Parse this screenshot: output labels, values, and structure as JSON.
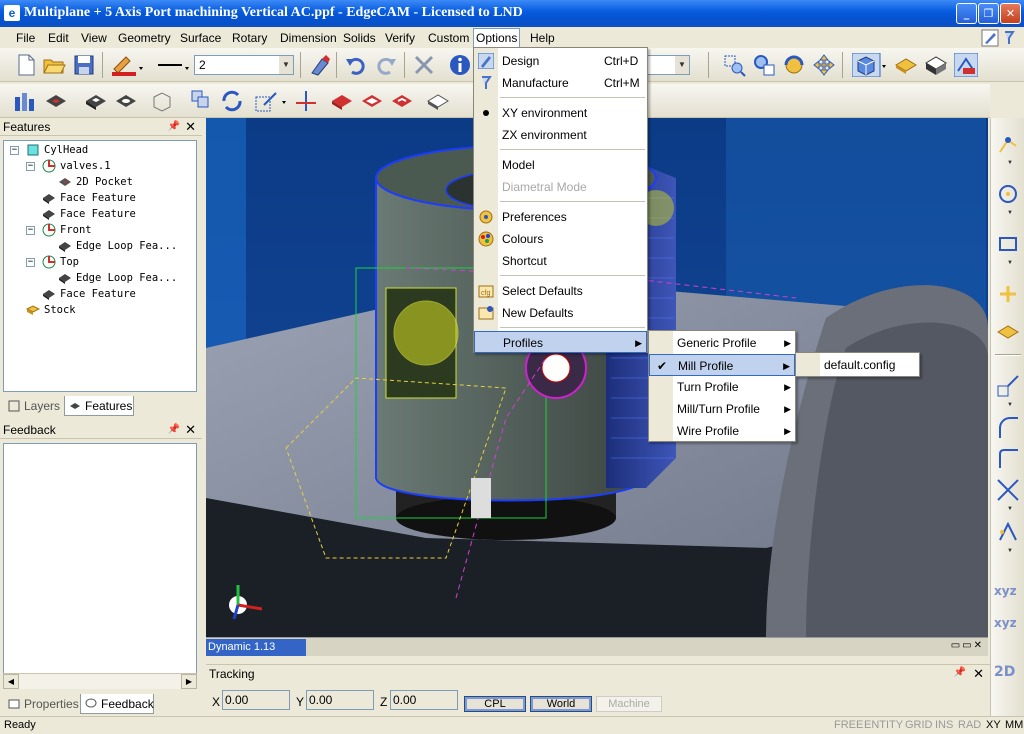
{
  "window": {
    "title": "Multiplane + 5 Axis Port machining Vertical AC.ppf - EdgeCAM - Licensed to LND",
    "app_icon": "edgecam-app-icon",
    "controls": {
      "minimize": "_",
      "maximize": "❐",
      "close": "✕"
    }
  },
  "menubar": {
    "items": [
      "File",
      "Edit",
      "View",
      "Geometry",
      "Surface",
      "Rotary",
      "Dimension",
      "Solids",
      "Verify",
      "Custom",
      "Options",
      "Help"
    ],
    "open_item": "Options"
  },
  "toolbar": {
    "line_weight_value": "2"
  },
  "features_panel": {
    "title": "Features",
    "tree": [
      {
        "label": "CylHead",
        "icon": "cube-icon"
      },
      {
        "label": "valves.1",
        "icon": "plane-icon"
      },
      {
        "label": "2D Pocket",
        "icon": "pocket-icon"
      },
      {
        "label": "Face Feature",
        "icon": "face-feature-icon"
      },
      {
        "label": "Face Feature",
        "icon": "face-feature-icon"
      },
      {
        "label": "Front",
        "icon": "plane-icon"
      },
      {
        "label": "Edge Loop Fea...",
        "icon": "face-feature-icon"
      },
      {
        "label": "Top",
        "icon": "plane-icon"
      },
      {
        "label": "Edge Loop Fea...",
        "icon": "face-feature-icon"
      },
      {
        "label": "Face Feature",
        "icon": "face-feature-icon"
      },
      {
        "label": "Stock",
        "icon": "stock-icon"
      }
    ],
    "tabs": [
      "Layers",
      "Features"
    ],
    "active_tab": "Features"
  },
  "feedback_panel": {
    "title": "Feedback",
    "tabs": [
      "Properties",
      "Feedback"
    ],
    "active_tab": "Feedback"
  },
  "viewport": {
    "status": "Dynamic 1.13"
  },
  "tracking": {
    "title": "Tracking",
    "x_label": "X",
    "x_value": "0.00",
    "y_label": "Y",
    "y_value": "0.00",
    "z_label": "Z",
    "z_value": "0.00",
    "buttons": [
      "CPL",
      "World",
      "Machine"
    ]
  },
  "right_toolbar": {
    "labels": [
      "xyz",
      "xyz",
      "2D"
    ]
  },
  "options_menu": {
    "items": [
      {
        "label": "Design",
        "shortcut": "Ctrl+D",
        "icon": "pen-icon"
      },
      {
        "label": "Manufacture",
        "shortcut": "Ctrl+M",
        "icon": "tool-icon"
      },
      {
        "label": "XY environment",
        "checked": true
      },
      {
        "label": "ZX environment"
      },
      {
        "label": "Model"
      },
      {
        "label": "Diametral Mode",
        "disabled": true
      },
      {
        "label": "Preferences",
        "icon": "preferences-icon"
      },
      {
        "label": "Colours",
        "icon": "colours-icon"
      },
      {
        "label": "Shortcut"
      },
      {
        "label": "Select Defaults",
        "icon": "select-defaults-icon"
      },
      {
        "label": "New Defaults",
        "icon": "new-defaults-icon"
      },
      {
        "label": "Profiles",
        "submenu": true
      }
    ]
  },
  "profiles_menu": {
    "items": [
      "Generic Profile",
      "Mill Profile",
      "Turn Profile",
      "Mill/Turn Profile",
      "Wire Profile"
    ],
    "checked": "Mill Profile"
  },
  "mill_profile_menu": {
    "items": [
      "default.config"
    ]
  },
  "statusbar": {
    "ready": "Ready",
    "indicators": [
      "FREE",
      "ENTITY",
      "GRID",
      "INS",
      "RAD",
      "XY",
      "MM"
    ],
    "active_indicators": [
      "XY",
      "MM"
    ]
  }
}
